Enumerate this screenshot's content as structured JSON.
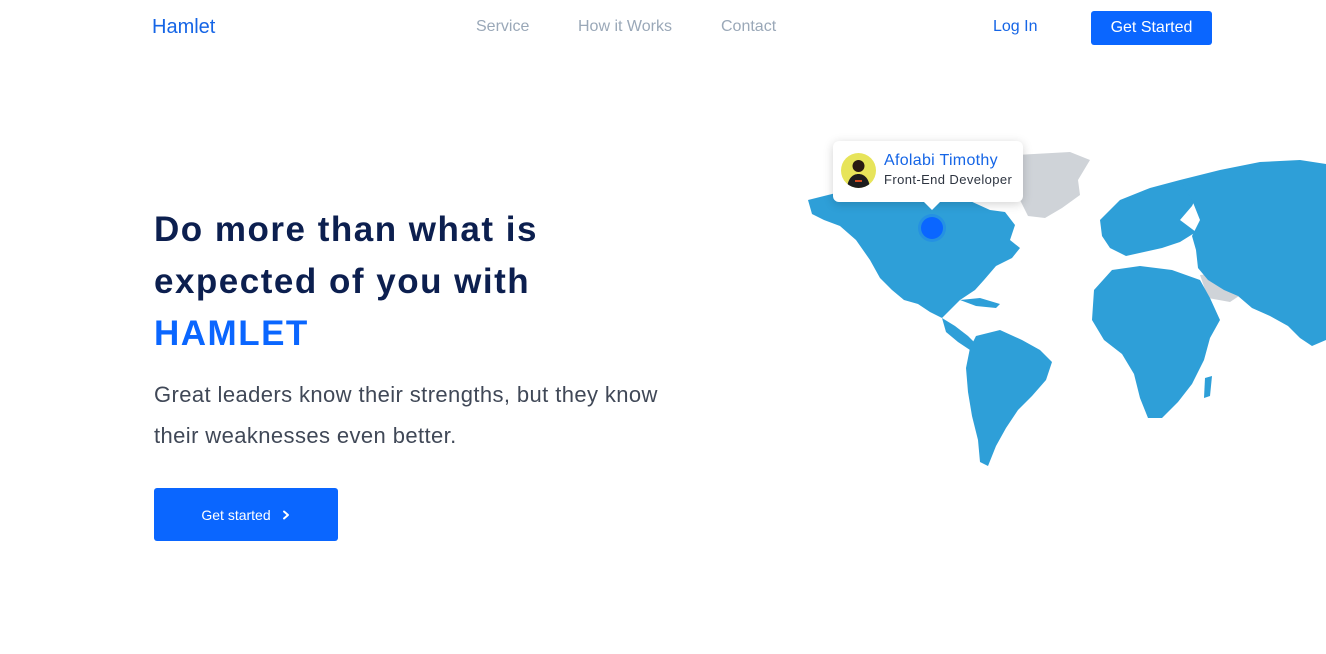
{
  "nav": {
    "logo": "Hamlet",
    "links": [
      "Service",
      "How it Works",
      "Contact"
    ],
    "login": "Log In",
    "get_started": "Get Started"
  },
  "hero": {
    "headline_line1": "Do more than what is",
    "headline_line2": "expected of you with",
    "headline_brand": "HAMLET",
    "subtitle": "Great leaders know their strengths, but they know their weaknesses even better.",
    "cta_label": "Get started",
    "cta_icon": "chevron-right-icon"
  },
  "profile_card": {
    "name": "Afolabi Timothy",
    "role": "Front-End Developer",
    "avatar_icon": "user-avatar"
  },
  "map": {
    "land_color": "#2e9fd8",
    "inactive_color": "#cfd3d8",
    "pin_color": "#0a66ff"
  },
  "colors": {
    "accent": "#0a66ff",
    "heading": "#0c1f4f",
    "nav_muted": "#9aa8b8"
  }
}
